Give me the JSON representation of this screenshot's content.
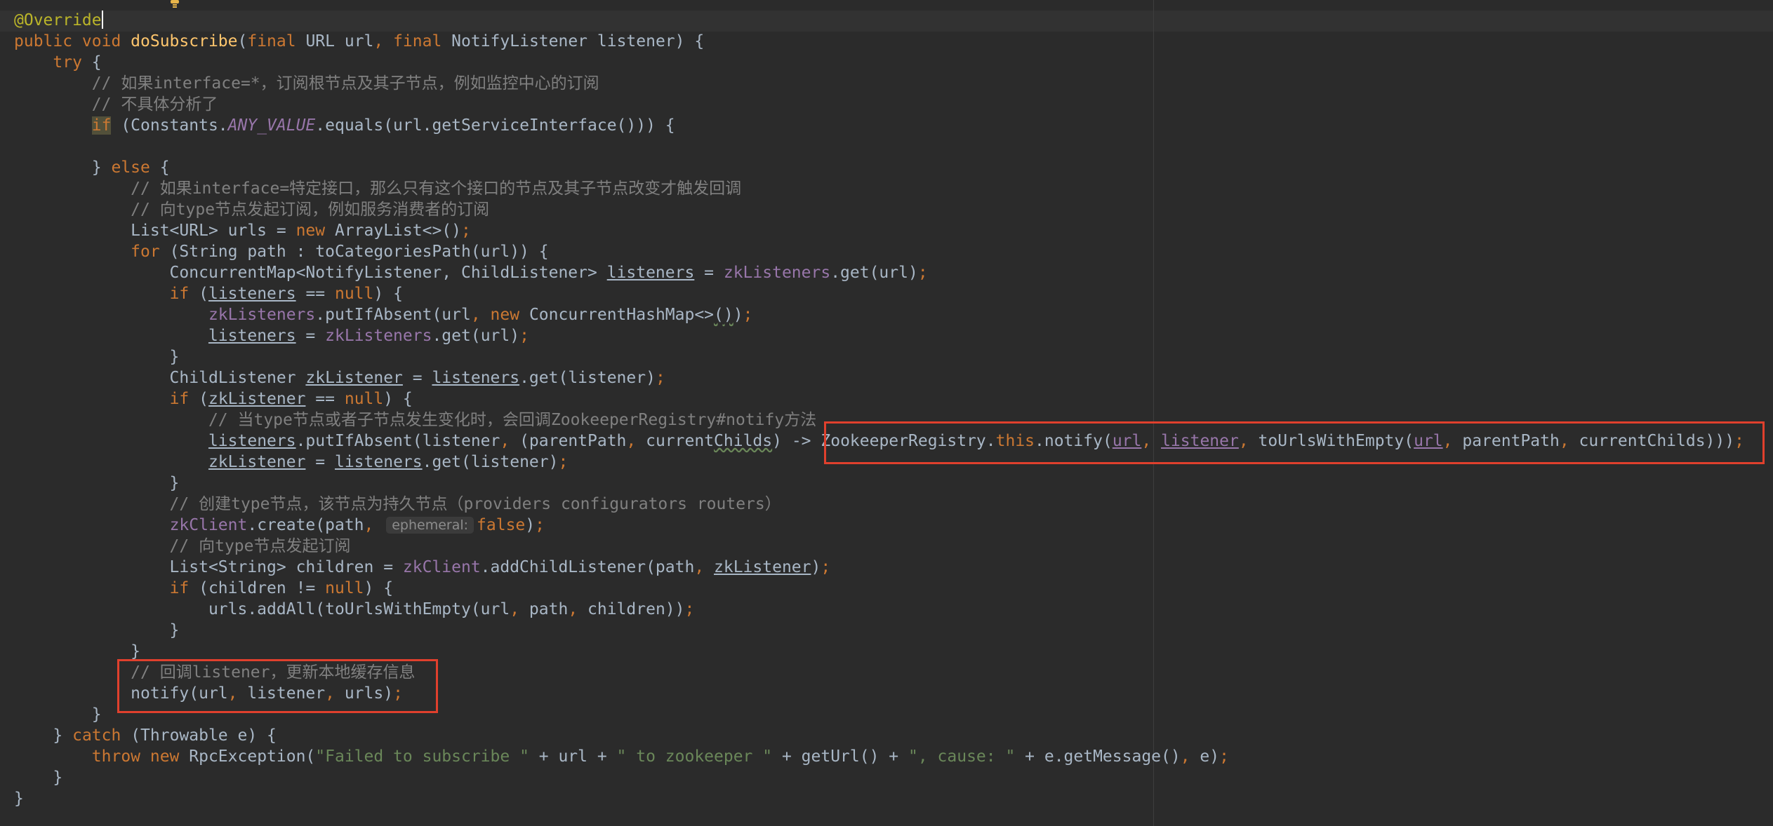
{
  "lines": [
    {
      "name": "line-annotation",
      "spans": [
        [
          "ann",
          "@Override"
        ]
      ],
      "caret": true
    },
    {
      "name": "line-method-signature",
      "spans": [
        [
          "kw",
          "public void "
        ],
        [
          "fn",
          "doSubscribe"
        ],
        [
          "pl",
          "("
        ],
        [
          "kw",
          "final "
        ],
        [
          "pl",
          "URL url"
        ],
        [
          "kw",
          ", final "
        ],
        [
          "pl",
          "NotifyListener listener) {"
        ]
      ]
    },
    {
      "name": "line-try",
      "spans": [
        [
          "pl",
          "    "
        ],
        [
          "kw",
          "try "
        ],
        [
          "pl",
          "{"
        ]
      ]
    },
    {
      "name": "line-comment-1",
      "spans": [
        [
          "cm",
          "        // 如果interface=*，订阅根节点及其子节点，例如监控中心的订阅"
        ]
      ]
    },
    {
      "name": "line-comment-2",
      "spans": [
        [
          "cm",
          "        // 不具体分析了"
        ]
      ]
    },
    {
      "name": "line-if-any-value",
      "spans": [
        [
          "pl",
          "        "
        ],
        [
          "kw hl-if",
          "if"
        ],
        [
          "pl",
          " (Constants."
        ],
        [
          "const",
          "ANY_VALUE"
        ],
        [
          "pl",
          ".equals(url.getServiceInterface())) {"
        ]
      ]
    },
    {
      "name": "line-blank-1",
      "spans": [
        [
          "pl",
          ""
        ]
      ]
    },
    {
      "name": "line-else",
      "spans": [
        [
          "pl",
          "        } "
        ],
        [
          "kw",
          "else "
        ],
        [
          "pl",
          "{"
        ]
      ]
    },
    {
      "name": "line-comment-3",
      "spans": [
        [
          "cm",
          "            // 如果interface=特定接口，那么只有这个接口的节点及其子节点改变才触发回调"
        ]
      ]
    },
    {
      "name": "line-comment-4",
      "spans": [
        [
          "cm",
          "            // 向type节点发起订阅，例如服务消费者的订阅"
        ]
      ]
    },
    {
      "name": "line-urls-decl",
      "spans": [
        [
          "pl",
          "            List<URL> urls = "
        ],
        [
          "kw",
          "new "
        ],
        [
          "pl",
          "ArrayList<>()"
        ],
        [
          "kw",
          ";"
        ]
      ]
    },
    {
      "name": "line-for",
      "spans": [
        [
          "pl",
          "            "
        ],
        [
          "kw",
          "for "
        ],
        [
          "pl",
          "(String path : toCategoriesPath(url)) {"
        ]
      ]
    },
    {
      "name": "line-listeners-decl",
      "spans": [
        [
          "pl",
          "                ConcurrentMap<NotifyListener, ChildListener> "
        ],
        [
          "var-u",
          "listeners"
        ],
        [
          "pl",
          " = "
        ],
        [
          "fld",
          "zkListeners"
        ],
        [
          "pl",
          ".get(url)"
        ],
        [
          "kw",
          ";"
        ]
      ]
    },
    {
      "name": "line-if-listeners-null",
      "spans": [
        [
          "pl",
          "                "
        ],
        [
          "kw",
          "if "
        ],
        [
          "pl",
          "("
        ],
        [
          "var-u",
          "listeners"
        ],
        [
          "pl",
          " == "
        ],
        [
          "kw",
          "null"
        ],
        [
          "pl",
          ") {"
        ]
      ]
    },
    {
      "name": "line-put-if-absent",
      "spans": [
        [
          "pl",
          "                    "
        ],
        [
          "fld",
          "zkListeners"
        ],
        [
          "pl",
          ".putIfAbsent(url"
        ],
        [
          "kw",
          ", new "
        ],
        [
          "pl",
          "ConcurrentHashMap<>"
        ],
        [
          "squig",
          "()"
        ],
        [
          "pl",
          ")"
        ],
        [
          "kw",
          ";"
        ]
      ]
    },
    {
      "name": "line-listeners-assign",
      "spans": [
        [
          "pl",
          "                    "
        ],
        [
          "var-u",
          "listeners"
        ],
        [
          "pl",
          " = "
        ],
        [
          "fld",
          "zkListeners"
        ],
        [
          "pl",
          ".get(url)"
        ],
        [
          "kw",
          ";"
        ]
      ]
    },
    {
      "name": "line-close-1",
      "spans": [
        [
          "pl",
          "                }"
        ]
      ]
    },
    {
      "name": "line-zklistener-decl",
      "spans": [
        [
          "pl",
          "                ChildListener "
        ],
        [
          "var-u",
          "zkListener"
        ],
        [
          "pl",
          " = "
        ],
        [
          "var-u",
          "listeners"
        ],
        [
          "pl",
          ".get(listener)"
        ],
        [
          "kw",
          ";"
        ]
      ]
    },
    {
      "name": "line-if-zklistener-null",
      "spans": [
        [
          "pl",
          "                "
        ],
        [
          "kw",
          "if "
        ],
        [
          "pl",
          "("
        ],
        [
          "var-u",
          "zkListener"
        ],
        [
          "pl",
          " == "
        ],
        [
          "kw",
          "null"
        ],
        [
          "pl",
          ") {"
        ]
      ]
    },
    {
      "name": "line-comment-5",
      "spans": [
        [
          "cm",
          "                    // 当type节点或者子节点发生变化时，会回调ZookeeperRegistry#notify方法"
        ]
      ]
    },
    {
      "name": "line-lambda",
      "spans": [
        [
          "pl",
          "                    "
        ],
        [
          "var-u",
          "listeners"
        ],
        [
          "pl",
          ".putIfAbsent(listener"
        ],
        [
          "kw",
          ", "
        ],
        [
          "pl",
          "(parentPath"
        ],
        [
          "kw",
          ", "
        ],
        [
          "pl",
          "current"
        ],
        [
          "squig",
          "Childs"
        ],
        [
          "pl",
          ") -> ZookeeperRegistry."
        ],
        [
          "kw",
          "this"
        ],
        [
          "pl",
          ".notify("
        ],
        [
          "fld-u",
          "url"
        ],
        [
          "kw",
          ", "
        ],
        [
          "fld-u",
          "listener"
        ],
        [
          "kw",
          ", "
        ],
        [
          "pl",
          "toUrlsWithEmpty("
        ],
        [
          "fld-u",
          "url"
        ],
        [
          "kw",
          ", "
        ],
        [
          "pl",
          "parentPath"
        ],
        [
          "kw",
          ", "
        ],
        [
          "pl",
          "currentChilds)))"
        ],
        [
          "kw",
          ";"
        ]
      ]
    },
    {
      "name": "line-zklistener-assign",
      "spans": [
        [
          "pl",
          "                    "
        ],
        [
          "var-u",
          "zkListener"
        ],
        [
          "pl",
          " = "
        ],
        [
          "var-u",
          "listeners"
        ],
        [
          "pl",
          ".get(listener)"
        ],
        [
          "kw",
          ";"
        ]
      ]
    },
    {
      "name": "line-close-2",
      "spans": [
        [
          "pl",
          "                }"
        ]
      ]
    },
    {
      "name": "line-comment-6",
      "spans": [
        [
          "cm",
          "                // 创建type节点，该节点为持久节点（providers configurators routers）"
        ]
      ]
    },
    {
      "name": "line-zkclient-create",
      "spans": [
        [
          "pl",
          "                "
        ],
        [
          "fld",
          "zkClient"
        ],
        [
          "pl",
          ".create(path"
        ],
        [
          "kw",
          ", "
        ],
        [
          "hint",
          "ephemeral:"
        ],
        [
          "kw",
          "false"
        ],
        [
          "pl",
          ")"
        ],
        [
          "kw",
          ";"
        ]
      ]
    },
    {
      "name": "line-comment-7",
      "spans": [
        [
          "cm",
          "                // 向type节点发起订阅"
        ]
      ]
    },
    {
      "name": "line-children-decl",
      "spans": [
        [
          "pl",
          "                List<String> children = "
        ],
        [
          "fld",
          "zkClient"
        ],
        [
          "pl",
          ".addChildListener(path"
        ],
        [
          "kw",
          ", "
        ],
        [
          "var-u",
          "zkListener"
        ],
        [
          "pl",
          ")"
        ],
        [
          "kw",
          ";"
        ]
      ]
    },
    {
      "name": "line-if-children",
      "spans": [
        [
          "pl",
          "                "
        ],
        [
          "kw",
          "if "
        ],
        [
          "pl",
          "(children != "
        ],
        [
          "kw",
          "null"
        ],
        [
          "pl",
          ") {"
        ]
      ]
    },
    {
      "name": "line-add-all",
      "spans": [
        [
          "pl",
          "                    urls.addAll(toUrlsWithEmpty(url"
        ],
        [
          "kw",
          ", "
        ],
        [
          "pl",
          "path"
        ],
        [
          "kw",
          ", "
        ],
        [
          "pl",
          "children))"
        ],
        [
          "kw",
          ";"
        ]
      ]
    },
    {
      "name": "line-close-3",
      "spans": [
        [
          "pl",
          "                }"
        ]
      ]
    },
    {
      "name": "line-close-for",
      "spans": [
        [
          "pl",
          "            }"
        ]
      ]
    },
    {
      "name": "line-comment-8",
      "spans": [
        [
          "cm",
          "            // 回调listener，更新本地缓存信息"
        ]
      ]
    },
    {
      "name": "line-notify",
      "spans": [
        [
          "pl",
          "            notify(url"
        ],
        [
          "kw",
          ", "
        ],
        [
          "pl",
          "listener"
        ],
        [
          "kw",
          ", "
        ],
        [
          "pl",
          "urls)"
        ],
        [
          "kw",
          ";"
        ]
      ]
    },
    {
      "name": "line-close-else",
      "spans": [
        [
          "pl",
          "        }"
        ]
      ]
    },
    {
      "name": "line-catch",
      "spans": [
        [
          "pl",
          "    } "
        ],
        [
          "kw",
          "catch "
        ],
        [
          "pl",
          "(Throwable e) {"
        ]
      ]
    },
    {
      "name": "line-throw",
      "spans": [
        [
          "pl",
          "        "
        ],
        [
          "kw",
          "throw new "
        ],
        [
          "pl",
          "RpcException("
        ],
        [
          "str",
          "\"Failed to subscribe \""
        ],
        [
          "pl",
          " + url + "
        ],
        [
          "str",
          "\" to zookeeper \""
        ],
        [
          "pl",
          " + getUrl() + "
        ],
        [
          "str",
          "\", cause: \""
        ],
        [
          "pl",
          " + e.getMessage()"
        ],
        [
          "kw",
          ", "
        ],
        [
          "pl",
          "e)"
        ],
        [
          "kw",
          ";"
        ]
      ]
    },
    {
      "name": "line-close-catch",
      "spans": [
        [
          "pl",
          "    }"
        ]
      ]
    },
    {
      "name": "line-close-method",
      "spans": [
        [
          "pl",
          "}"
        ]
      ]
    }
  ],
  "colors": {
    "background": "#2b2b2b",
    "keyword": "#cc7832",
    "comment": "#808080",
    "annotation": "#bbb529",
    "method_name": "#ffc66d",
    "field": "#9876aa",
    "string": "#6a8759",
    "plain": "#a9b7c6",
    "highlight_box": "#e0402d"
  },
  "icons": {
    "gutter_bulb": "lightbulb-icon"
  }
}
